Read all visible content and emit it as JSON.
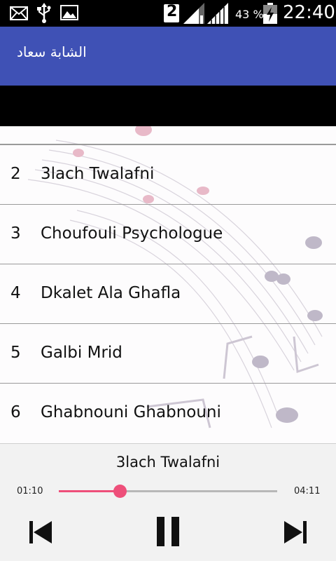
{
  "status_bar": {
    "icons": [
      "mail-icon",
      "usb-icon",
      "image-icon",
      "sim-2-icon",
      "signal-icon",
      "signal-icon",
      "battery-charging-icon"
    ],
    "sim_label": "2",
    "battery_percent": "43 %",
    "time": "22:40"
  },
  "app_bar": {
    "title": "الشابة سعاد",
    "color": "#3f51b5"
  },
  "songs": [
    {
      "num": "2",
      "title": "3lach Twalafni"
    },
    {
      "num": "3",
      "title": "Choufouli Psychologue"
    },
    {
      "num": "4",
      "title": "Dkalet Ala Ghafla"
    },
    {
      "num": "5",
      "title": "Galbi Mrid"
    },
    {
      "num": "6",
      "title": "Ghabnouni Ghabnouni"
    }
  ],
  "player": {
    "now_playing": "3lach Twalafni",
    "current_time": "01:10",
    "total_time": "04:11",
    "progress": 0.28,
    "accent_color": "#ee4f7a",
    "controls": [
      "previous-icon",
      "pause-icon",
      "next-icon"
    ]
  }
}
